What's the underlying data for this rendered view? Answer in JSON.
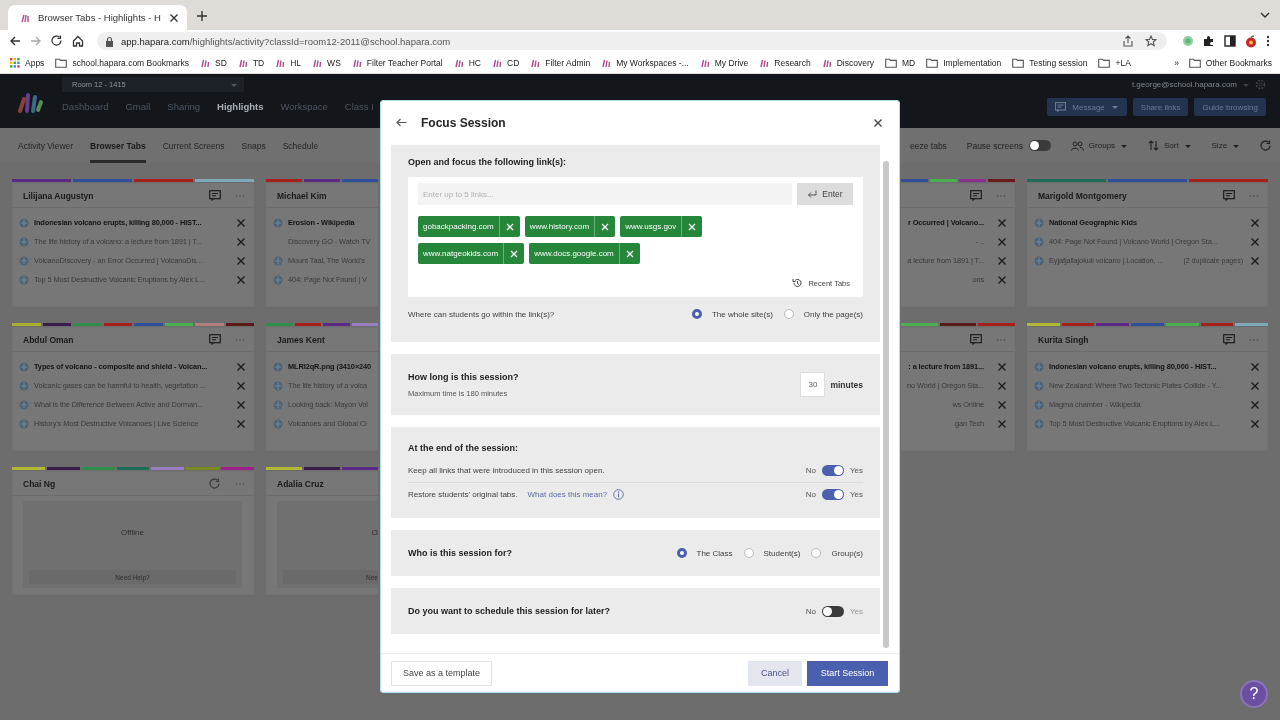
{
  "browser": {
    "tab_title": "Browser Tabs - Highlights - H",
    "url_host": "app.hapara.com",
    "url_path": "/highlights/activity?classId=room12-2011@school.hapara.com",
    "bookmarks": [
      {
        "label": "Apps",
        "kind": "apps"
      },
      {
        "label": "school.hapara.com Bookmarks",
        "kind": "folder"
      },
      {
        "label": "SD",
        "kind": "site"
      },
      {
        "label": "TD",
        "kind": "site"
      },
      {
        "label": "HL",
        "kind": "site"
      },
      {
        "label": "WS",
        "kind": "site"
      },
      {
        "label": "Filter Teacher Portal",
        "kind": "site"
      },
      {
        "label": "HC",
        "kind": "site"
      },
      {
        "label": "CD",
        "kind": "site"
      },
      {
        "label": "Filter Admin",
        "kind": "site"
      },
      {
        "label": "My Workspaces -...",
        "kind": "site"
      },
      {
        "label": "My Drive",
        "kind": "site"
      },
      {
        "label": "Research",
        "kind": "site"
      },
      {
        "label": "Discovery",
        "kind": "site"
      },
      {
        "label": "MD",
        "kind": "folder"
      },
      {
        "label": "Implementation",
        "kind": "folder"
      },
      {
        "label": "Testing session",
        "kind": "folder"
      },
      {
        "label": "+LA",
        "kind": "folder"
      }
    ],
    "overflow": "»",
    "other_bookmarks": "Other Bookmarks"
  },
  "app": {
    "class_select": "Room 12 - 1415",
    "nav": [
      {
        "label": "Dashboard",
        "selected": false
      },
      {
        "label": "Gmail",
        "selected": false
      },
      {
        "label": "Sharing",
        "selected": false
      },
      {
        "label": "Highlights",
        "selected": true
      },
      {
        "label": "Workspace",
        "selected": false
      },
      {
        "label": "Class I",
        "selected": false
      }
    ],
    "user": "t.george@school.hapara.com",
    "actions": [
      {
        "label": "Message",
        "kind": "message"
      },
      {
        "label": "Share links",
        "kind": "plain"
      },
      {
        "label": "Guide browsing",
        "kind": "plain"
      }
    ]
  },
  "subnav": {
    "tabs": [
      {
        "label": "Activity Viewer",
        "selected": false
      },
      {
        "label": "Browser Tabs",
        "selected": true
      },
      {
        "label": "Current Screens",
        "selected": false
      },
      {
        "label": "Snaps",
        "selected": false
      },
      {
        "label": "Schedule",
        "selected": false
      }
    ],
    "tools": [
      {
        "label": "eeze tabs",
        "kind": "text"
      },
      {
        "label": "Pause screens",
        "kind": "toggle",
        "on": false
      },
      {
        "label": "Groups",
        "kind": "groups"
      },
      {
        "label": "Sort",
        "kind": "sort"
      },
      {
        "label": "Size",
        "kind": "size"
      },
      {
        "kind": "refresh"
      }
    ]
  },
  "card_columns": [
    {
      "cards": [
        {
          "student": "Lilijana Augustyn",
          "kind": "online",
          "groups": [
            {
              "color": "#5b2a86"
            },
            {
              "color": "#2f4f9a"
            },
            {
              "color": "#a8201e"
            },
            {
              "color": "#7fa8b8"
            }
          ],
          "tabs": [
            {
              "title": "Indonesian volcano erupts, killing 80,000 - HIST...",
              "active": true,
              "favicon": true
            },
            {
              "title": "The life history of a volcano: a lecture from 1891 | T...",
              "active": false,
              "favicon": true
            },
            {
              "title": "VolcanoDiscovery - an Error Occurred | VolcanoDis...",
              "active": false,
              "favicon": true
            },
            {
              "title": "Top 5 Most Destructive Volcanic Eruptions by Alex L...",
              "active": false,
              "favicon": true
            }
          ]
        },
        {
          "student": "Abdul Oman",
          "kind": "online",
          "groups": [
            {
              "color": "#a8b030"
            },
            {
              "color": "#3a1d4a"
            },
            {
              "color": "#2f8f4a"
            },
            {
              "color": "#a8201e"
            },
            {
              "color": "#2f4f9a"
            },
            {
              "color": "#4caf50"
            },
            {
              "color": "#b08080"
            },
            {
              "color": "#5a1a1a"
            }
          ],
          "tabs": [
            {
              "title": "Types of volcano - composite and shield - Volcan...",
              "active": true,
              "favicon": true
            },
            {
              "title": "Volcanic gases can be harmful to health, vegetation ...",
              "active": false,
              "favicon": true
            },
            {
              "title": "What is the Difference Between Active and Dorman...",
              "active": false,
              "favicon": true
            },
            {
              "title": "History's Most Destructive Volcanoes | Live Science",
              "active": false,
              "favicon": true
            }
          ]
        },
        {
          "student": "Chai Ng",
          "kind": "offline",
          "groups": [
            {
              "color": "#b0b830"
            },
            {
              "color": "#3a1d4a"
            },
            {
              "color": "#2f8f4a"
            },
            {
              "color": "#1e6b5a"
            },
            {
              "color": "#9a7fc0"
            },
            {
              "color": "#7a8a20"
            },
            {
              "color": "#a0208a"
            }
          ],
          "status": "Offline",
          "help": "Need Help?"
        }
      ]
    },
    {
      "cards": [
        {
          "student": "Michael Kim",
          "kind": "online",
          "groups": [
            {
              "color": "#a8201e"
            },
            {
              "color": "#5b2a86"
            },
            {
              "color": "#2f4f9a"
            }
          ],
          "tabs": [
            {
              "title": "Erosion - Wikipedia",
              "active": true,
              "favicon": true
            },
            {
              "title": "Discovery GO - Watch TV",
              "active": false,
              "favicon": false
            },
            {
              "title": "Mount Taal, The World's",
              "active": false,
              "favicon": true
            },
            {
              "title": "404: Page Not Found | V",
              "active": false,
              "favicon": true
            }
          ]
        },
        {
          "student": "James Kent",
          "kind": "online",
          "groups": [
            {
              "color": "#2f8f4a"
            },
            {
              "color": "#a8201e"
            },
            {
              "color": "#5b2a86"
            },
            {
              "color": "#9a7fc0"
            }
          ],
          "tabs": [
            {
              "title": "MLRI2qR.png (3410×240",
              "active": true,
              "favicon": true
            },
            {
              "title": "The life history of a volca",
              "active": false,
              "favicon": true
            },
            {
              "title": "Looking back: Mayon Vol",
              "active": false,
              "favicon": true
            },
            {
              "title": "Volcanoes and Global Cl",
              "active": false,
              "favicon": true
            }
          ]
        },
        {
          "student": "Adalia Cruz",
          "kind": "offline",
          "groups": [
            {
              "color": "#b0b830"
            },
            {
              "color": "#3a1d4a"
            },
            {
              "color": "#5b2a86"
            }
          ],
          "status": "O",
          "help": "Nee"
        }
      ]
    },
    {
      "cards": [
        {
          "kind": "online",
          "groups": [
            {
              "color": "#2f4f9a"
            },
            {
              "color": "#4caf50"
            },
            {
              "color": "#8a2d8f"
            },
            {
              "color": "#6a1a1a"
            }
          ],
          "tabs": [
            {
              "title": "r Occurred | Volcano...",
              "active": true
            },
            {
              "title": "- ..",
              "active": false
            },
            {
              "title": "a lecture from 1891 | T...",
              "active": false
            },
            {
              "title": "ons",
              "active": false
            }
          ]
        },
        {
          "kind": "online",
          "groups": [
            {
              "color": "#4caf50"
            },
            {
              "color": "#5a1a1a"
            },
            {
              "color": "#a8201e"
            }
          ],
          "tabs": [
            {
              "title": ": a lecture from 1891...",
              "active": true
            },
            {
              "title": "no World | Oregon Sta...",
              "active": false
            },
            {
              "title": "ws Online",
              "active": false
            },
            {
              "title": "gan Tech",
              "active": false
            }
          ]
        }
      ]
    },
    {
      "cards": [
        {
          "student": "Marigold Montgomery",
          "kind": "online",
          "groups": [
            {
              "color": "#1e6b5a"
            },
            {
              "color": "#2f4f9a"
            },
            {
              "color": "#a8201e"
            }
          ],
          "tabs": [
            {
              "title": "National Geographic Kids",
              "active": true,
              "favicon": true
            },
            {
              "title": "404: Page Not Found | Volcano World | Oregon Sta...",
              "active": false,
              "favicon": true
            },
            {
              "title": "Eyjafjallajokull volcano | Location, ...",
              "active": false,
              "favicon": true,
              "note": "(2 duplicate pages)"
            }
          ]
        },
        {
          "student": "Kurita Singh",
          "kind": "online",
          "groups": [
            {
              "color": "#b0b830"
            },
            {
              "color": "#a8201e"
            },
            {
              "color": "#5b2a86"
            },
            {
              "color": "#2f4f9a"
            },
            {
              "color": "#4caf50"
            },
            {
              "color": "#a8201e"
            },
            {
              "color": "#7fa8b8"
            }
          ],
          "tabs": [
            {
              "title": "Indonesian volcano erupts, killing 80,000 - HIST...",
              "active": true,
              "favicon": true
            },
            {
              "title": "New Zealand: Where Two Tectonic Plates Collide - Y...",
              "active": false,
              "favicon": true
            },
            {
              "title": "Magma chamber - Wikipedia",
              "active": false,
              "favicon": true
            },
            {
              "title": "Top 5 Most Destructive Volcanic Eruptions by Alex L...",
              "active": false,
              "favicon": true
            }
          ]
        }
      ]
    }
  ],
  "modal": {
    "title": "Focus Session",
    "links": {
      "heading": "Open and focus the following link(s):",
      "placeholder": "Enter up to 5 links...",
      "enter": "Enter",
      "chips": [
        "gobackpacking.com",
        "www.history.com",
        "www.usgs.gov",
        "www.natgeokids.com",
        "www.docs.google.com"
      ],
      "recent": "Recent Tabs",
      "scope_question": "Where can students go within the link(s)?",
      "scope_options": [
        {
          "label": "The whole site(s)",
          "selected": true
        },
        {
          "label": "Only the page(s)",
          "selected": false
        }
      ]
    },
    "duration": {
      "heading": "How long is this session?",
      "hint": "Maximum time is 180 minutes",
      "value": "30",
      "unit": "minutes"
    },
    "end": {
      "heading": "At the end of the session:",
      "options": [
        {
          "label": "Keep all links that were introduced in this session open.",
          "no": "No",
          "yes": "Yes",
          "on": true
        },
        {
          "label": "Restore students’ original tabs.",
          "link": "What does this mean?",
          "no": "No",
          "yes": "Yes",
          "on": true
        }
      ]
    },
    "audience": {
      "heading": "Who is this session for?",
      "options": [
        {
          "label": "The Class",
          "selected": true
        },
        {
          "label": "Student(s)",
          "selected": false
        },
        {
          "label": "Group(s)",
          "selected": false
        }
      ]
    },
    "schedule": {
      "heading": "Do you want to schedule this session for later?",
      "no": "No",
      "yes": "Yes",
      "on": false
    },
    "save_template": "Save as a template",
    "cancel": "Cancel",
    "start": "Start Session"
  },
  "help_button": "?"
}
